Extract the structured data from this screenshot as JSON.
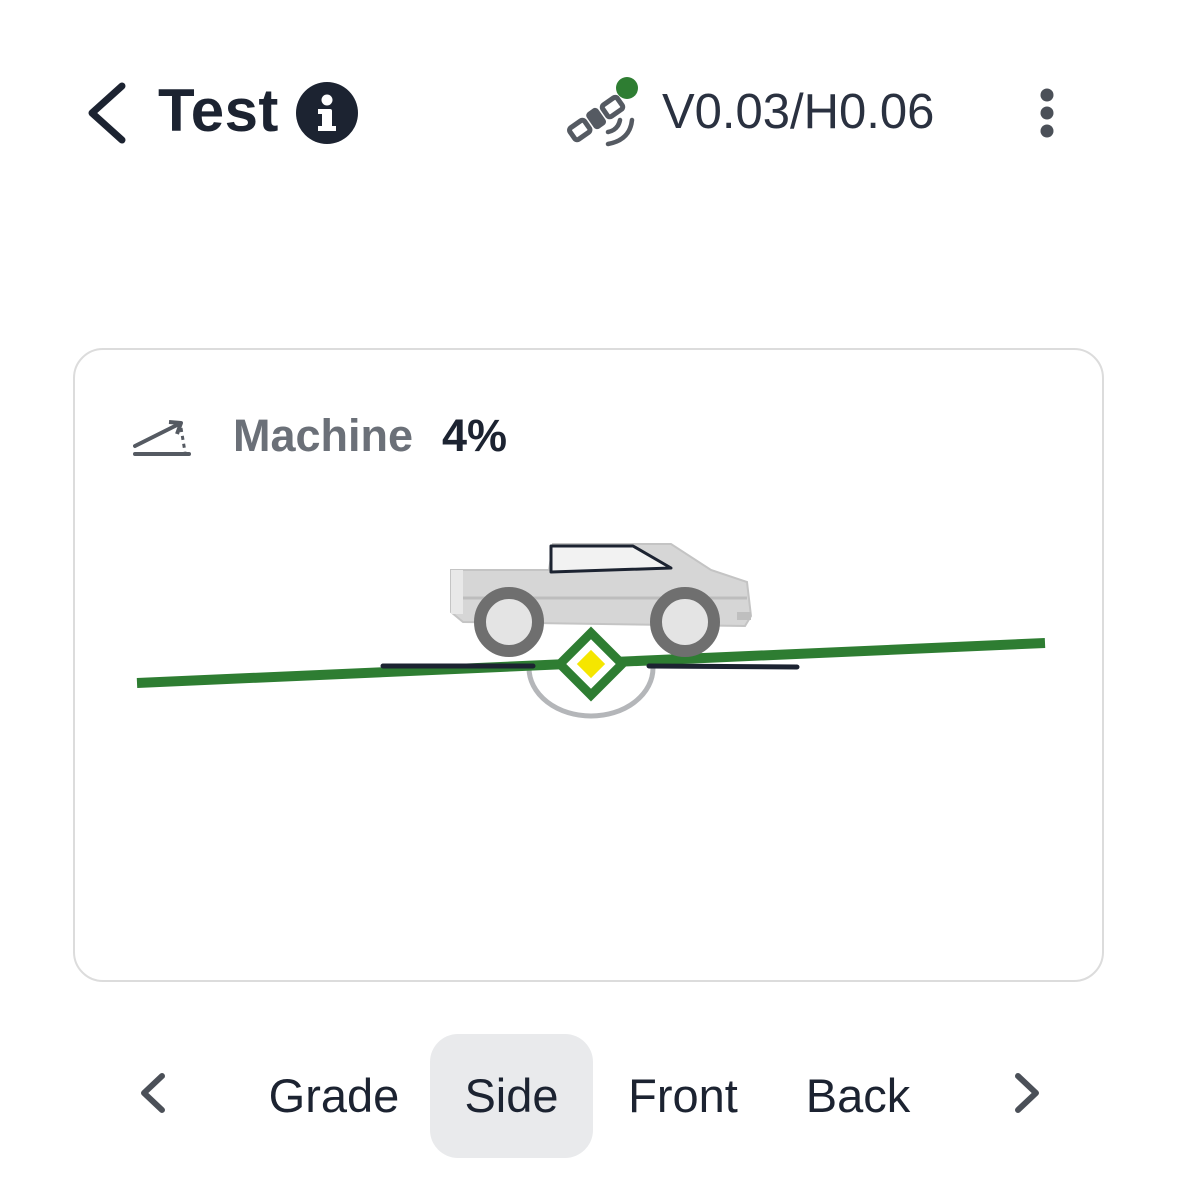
{
  "header": {
    "title": "Test",
    "accuracy": "V0.03/H0.06",
    "icons": {
      "back": "chevron-left-icon",
      "info": "info-icon",
      "gnss": "satellite-icon",
      "menu": "more-vertical-icon"
    },
    "gnss_status_color": "#2e7d32"
  },
  "card": {
    "metric_label": "Machine",
    "metric_value": "4%",
    "slope_icon": "slope-icon",
    "colors": {
      "grade_line": "#2e7d32",
      "target_marker_fill": "#f5e600",
      "machine_reference": "#1c2331"
    }
  },
  "tabs": {
    "items": [
      {
        "label": "Grade",
        "active": false
      },
      {
        "label": "Side",
        "active": true
      },
      {
        "label": "Front",
        "active": false
      },
      {
        "label": "Back",
        "active": false
      }
    ],
    "icons": {
      "prev": "chevron-left-icon",
      "next": "chevron-right-icon"
    }
  }
}
